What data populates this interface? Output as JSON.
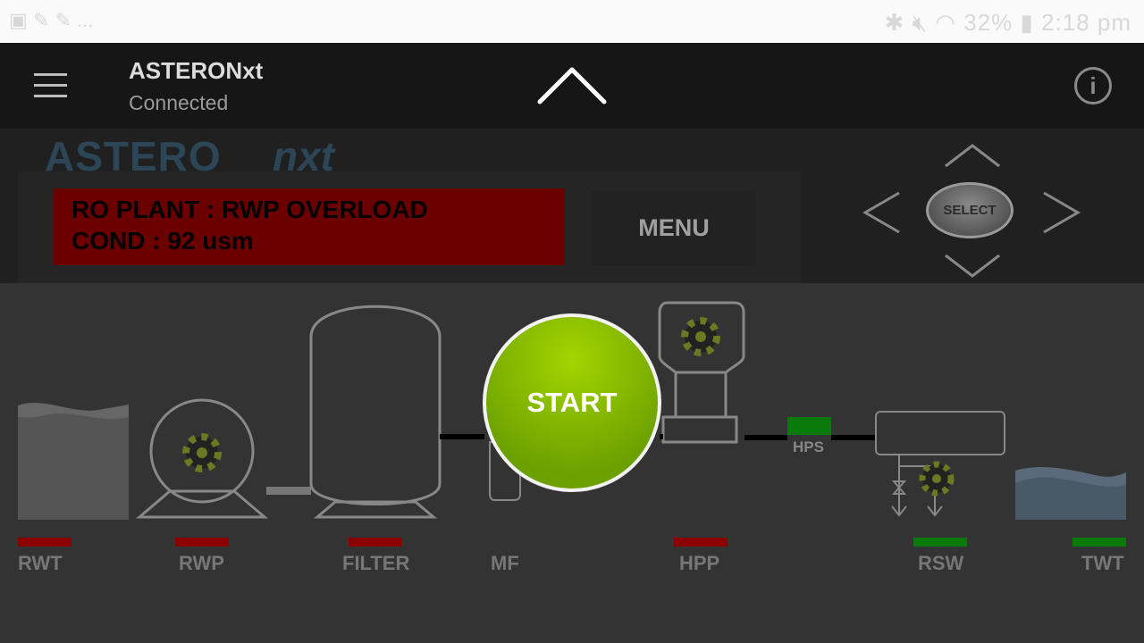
{
  "status_bar": {
    "notifications": "▣ ✎ ✎ ...",
    "battery": "32%",
    "time": "2:18 pm"
  },
  "app_bar": {
    "title": "ASTERONxt",
    "subtitle": "Connected",
    "info_label": "i"
  },
  "display": {
    "logo_text": "ASTERO nxt",
    "alarm_line1": "RO PLANT : RWP OVERLOAD",
    "alarm_line2": "COND :  92 usm",
    "menu_label": "MENU"
  },
  "nav": {
    "select_label": "SELECT"
  },
  "control": {
    "start_label": "START"
  },
  "sensor": {
    "hps_label": "HPS",
    "hps_color": "#0a7a0a"
  },
  "components": [
    {
      "label": "RWT",
      "status_color": "#8b0000"
    },
    {
      "label": "RWP",
      "status_color": "#8b0000"
    },
    {
      "label": "FILTER",
      "status_color": "#8b0000"
    },
    {
      "label": "MF",
      "status_color": ""
    },
    {
      "label": "HPP",
      "status_color": "#8b0000"
    },
    {
      "label": "RSW",
      "status_color": "#0a7a0a"
    },
    {
      "label": "TWT",
      "status_color": "#0a7a0a"
    }
  ]
}
